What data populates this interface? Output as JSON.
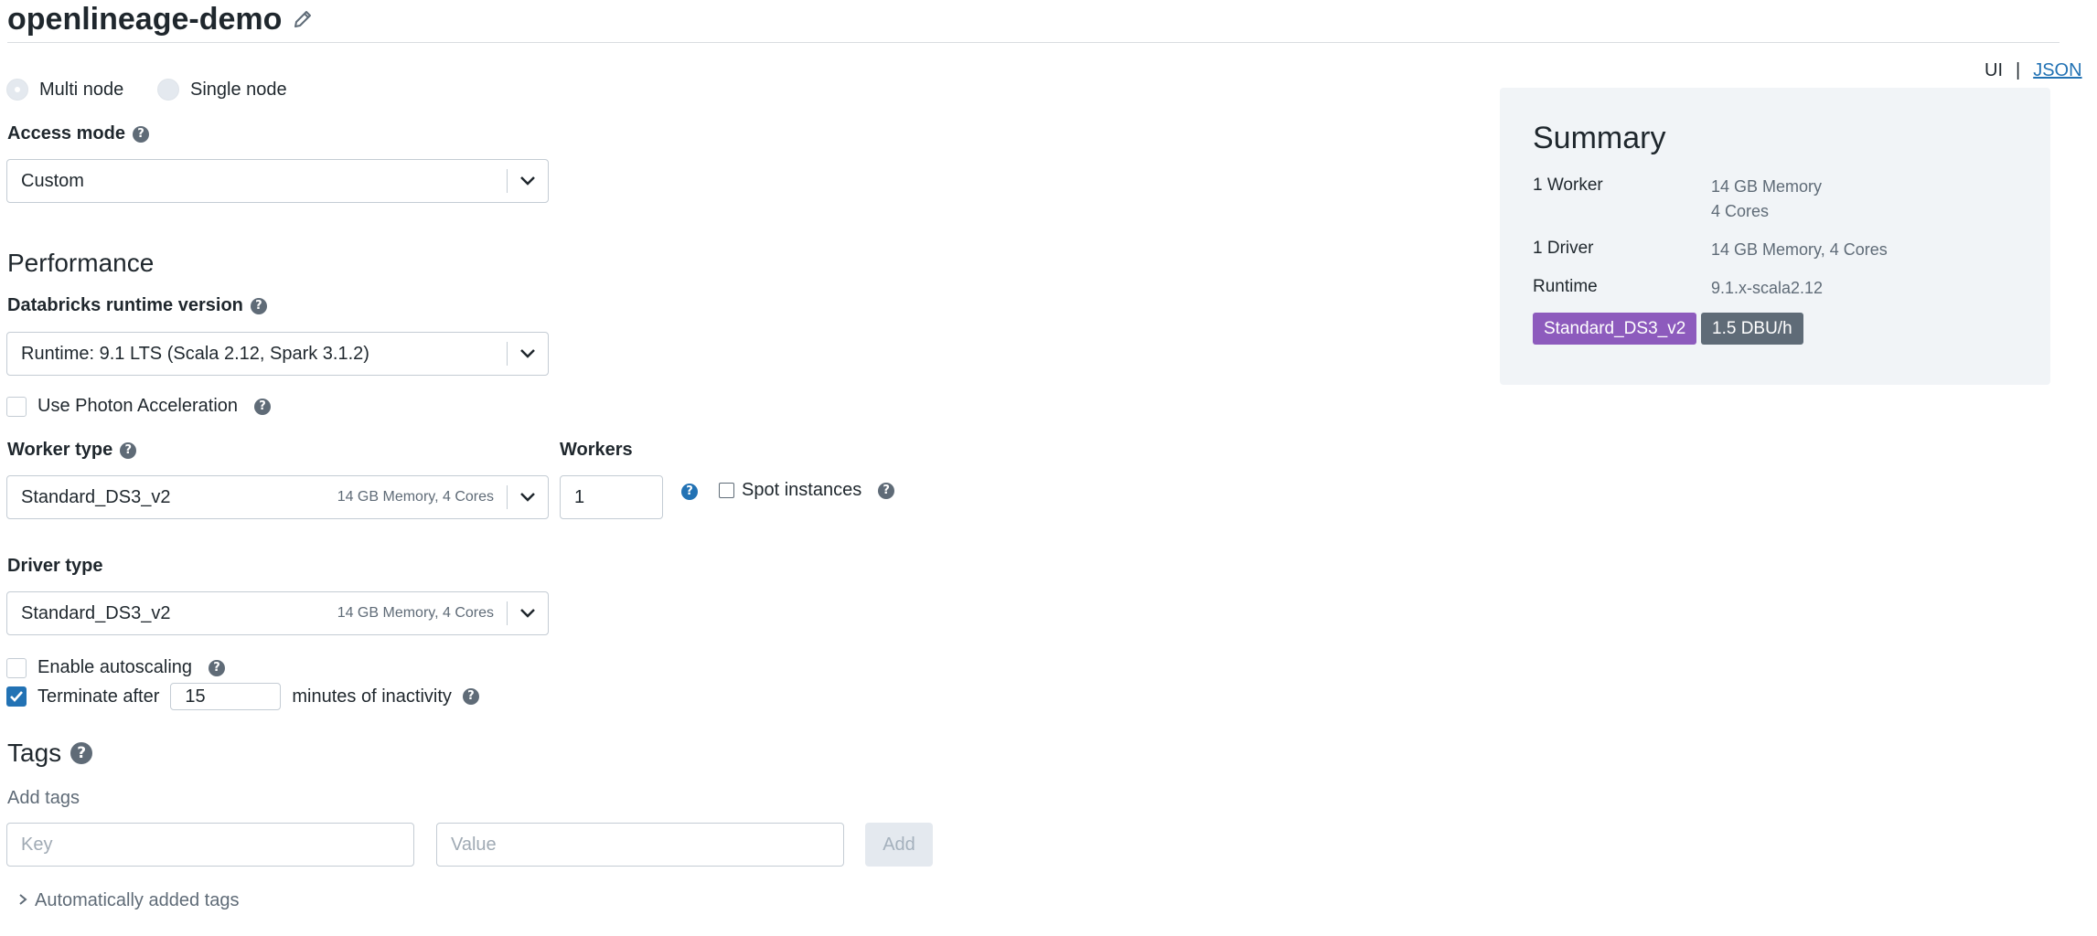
{
  "page": {
    "title": "openlineage-demo",
    "view_toggle": {
      "ui": "UI",
      "sep": "|",
      "json": "JSON"
    }
  },
  "node_type": {
    "multi": "Multi node",
    "single": "Single node",
    "selected": "multi"
  },
  "access_mode": {
    "label": "Access mode",
    "value": "Custom"
  },
  "performance": {
    "heading": "Performance",
    "runtime_label": "Databricks runtime version",
    "runtime_value": "Runtime: 9.1 LTS (Scala 2.12, Spark 3.1.2)",
    "photon_label": "Use Photon Acceleration",
    "photon_checked": false,
    "worker_type_label": "Worker type",
    "worker_type_value": "Standard_DS3_v2",
    "worker_type_hint": "14 GB Memory, 4 Cores",
    "workers_label": "Workers",
    "workers_value": "1",
    "spot_label": "Spot instances",
    "spot_checked": false,
    "driver_type_label": "Driver type",
    "driver_type_value": "Standard_DS3_v2",
    "driver_type_hint": "14 GB Memory, 4 Cores",
    "autoscaling_label": "Enable autoscaling",
    "autoscaling_checked": false,
    "terminate_label": "Terminate after",
    "terminate_value": "15",
    "terminate_suffix": "minutes of inactivity",
    "terminate_checked": true
  },
  "tags": {
    "heading": "Tags",
    "add_label": "Add tags",
    "key_placeholder": "Key",
    "value_placeholder": "Value",
    "add_button": "Add",
    "auto_tags": "Automatically added tags"
  },
  "summary": {
    "title": "Summary",
    "rows": [
      {
        "key": "1 Worker",
        "value_line1": "14 GB Memory",
        "value_line2": "4 Cores"
      },
      {
        "key": "1 Driver",
        "value_line1": "14 GB Memory, 4 Cores"
      },
      {
        "key": "Runtime",
        "value_line1": "9.1.x-scala2.12"
      }
    ],
    "badge_type": "Standard_DS3_v2",
    "badge_dbu": "1.5 DBU/h",
    "badge_type_color": "#8d5bbd",
    "badge_dbu_color": "#5f6b77"
  },
  "colors": {
    "accent": "#2272b4",
    "text": "#1f272d",
    "muted": "#5f6b77"
  }
}
